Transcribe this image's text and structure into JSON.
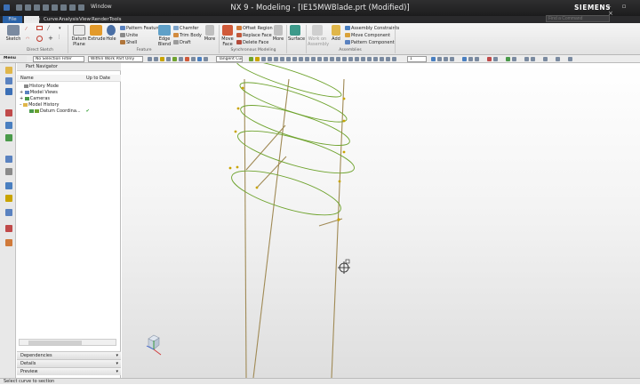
{
  "window": {
    "title": "NX 9 - Modeling - [IE15MWBlade.prt (Modified)]",
    "brand": "SIEMENS",
    "menu_label": "Window",
    "controls": "– ▫ ×"
  },
  "tabs": [
    "File",
    "Home",
    "Curve",
    "Analysis",
    "View",
    "Render",
    "Tools"
  ],
  "search": {
    "placeholder": "Find a Command"
  },
  "ribbon": {
    "sketch": "Sketch",
    "datum_plane": "Datum Plane",
    "extrude": "Extrude",
    "hole": "Hole",
    "pattern_feature": "Pattern Feature",
    "unite": "Unite",
    "shell": "Shell",
    "edge_blend": "Edge Blend",
    "chamfer": "Chamfer",
    "trim_body": "Trim Body",
    "draft": "Draft",
    "more": "More",
    "move_face": "Move Face",
    "offset_region": "Offset Region",
    "replace_face": "Replace Face",
    "delete_face": "Delete Face",
    "surface": "Surface",
    "work_on_assembly": "Work on Assembly",
    "add": "Add",
    "assembly_constraints": "Assembly Constraints",
    "move_component": "Move Component",
    "pattern_component": "Pattern Component",
    "groups": {
      "direct_sketch": "Direct Sketch",
      "feature": "Feature",
      "synchronous_modeling": "Synchronous Modeling",
      "assemblies": "Assemblies"
    }
  },
  "selection_bar": {
    "menu": "Menu",
    "filter": "No Selection Filter",
    "scope": "Within Work Part Only",
    "curve_rule": "Tangent Curves",
    "number": "1"
  },
  "navigator": {
    "title": "Part Navigator",
    "col_name": "Name",
    "col_uptodate": "Up to Date",
    "items": [
      {
        "label": "History Mode"
      },
      {
        "label": "Model Views"
      },
      {
        "label": "Cameras"
      },
      {
        "label": "Model History"
      },
      {
        "label": "Datum Coordina...",
        "status": "✔"
      }
    ],
    "sections": [
      "Dependencies",
      "Details",
      "Preview"
    ]
  },
  "status": {
    "message": "Select curve to section"
  },
  "colors": {
    "accent": "#2962a8",
    "spline": "#6fa32e",
    "line": "#a08a55",
    "point": "#c9a400"
  }
}
